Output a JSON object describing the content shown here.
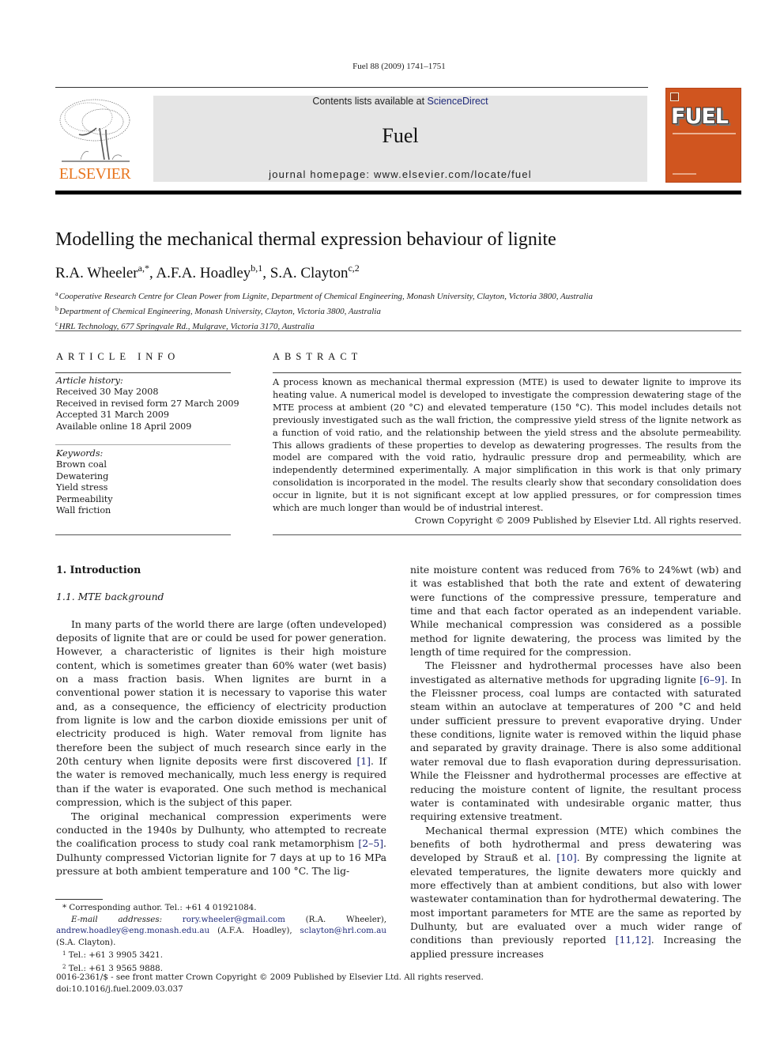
{
  "running_head": "Fuel 88 (2009) 1741–1751",
  "header": {
    "publisher_logo_text": "ELSEVIER",
    "contents_prefix": "Contents lists available at ",
    "contents_link": "ScienceDirect",
    "journal_name": "Fuel",
    "homepage": "journal homepage: www.elsevier.com/locate/fuel",
    "cover_title": "FUEL"
  },
  "colors": {
    "publisher_orange": "#e8761f",
    "cover_orange": "#d0551f",
    "link_blue": "#1f2a7a",
    "header_box_gray": "#e5e5e5"
  },
  "article": {
    "title": "Modelling the mechanical thermal expression behaviour of lignite",
    "authors": [
      {
        "name": "R.A. Wheeler",
        "sup": "a,*",
        "sep": ", "
      },
      {
        "name": "A.F.A. Hoadley",
        "sup": "b,1",
        "sep": ", "
      },
      {
        "name": "S.A. Clayton",
        "sup": "c,2",
        "sep": ""
      }
    ],
    "affiliations": [
      {
        "mark": "a",
        "text": "Cooperative Research Centre for Clean Power from Lignite, Department of Chemical Engineering, Monash University, Clayton, Victoria 3800, Australia"
      },
      {
        "mark": "b",
        "text": "Department of Chemical Engineering, Monash University, Clayton, Victoria 3800, Australia"
      },
      {
        "mark": "c",
        "text": "HRL Technology, 677 Springvale Rd., Mulgrave, Victoria 3170, Australia"
      }
    ]
  },
  "article_info": {
    "heading": "ARTICLE INFO",
    "history_label": "Article history:",
    "history": [
      "Received 30 May 2008",
      "Received in revised form 27 March 2009",
      "Accepted 31 March 2009",
      "Available online 18 April 2009"
    ],
    "keywords_label": "Keywords:",
    "keywords": [
      "Brown coal",
      "Dewatering",
      "Yield stress",
      "Permeability",
      "Wall friction"
    ]
  },
  "abstract": {
    "heading": "ABSTRACT",
    "text": "A process known as mechanical thermal expression (MTE) is used to dewater lignite to improve its heating value. A numerical model is developed to investigate the compression dewatering stage of the MTE process at ambient (20 °C) and elevated temperature (150 °C). This model includes details not previously investigated such as the wall friction, the compressive yield stress of the lignite network as a function of void ratio, and the relationship between the yield stress and the absolute permeability. This allows gradients of these properties to develop as dewatering progresses. The results from the model are compared with the void ratio, hydraulic pressure drop and permeability, which are independently determined experimentally. A major simplification in this work is that only primary consolidation is incorporated in the model. The results clearly show that secondary consolidation does occur in lignite, but it is not significant except at low applied pressures, or for compression times which are much longer than would be of industrial interest.",
    "copyright": "Crown Copyright © 2009 Published by Elsevier Ltd. All rights reserved."
  },
  "body": {
    "section_heading": "1. Introduction",
    "subsection_heading": "1.1. MTE background",
    "left_paragraphs": [
      {
        "parts": [
          {
            "t": "In many parts of the world there are large (often undeveloped) deposits of lignite that are or could be used for power generation. However, a characteristic of lignites is their high moisture content, which is sometimes greater than 60% water (wet basis) on a mass fraction basis. When lignites are burnt in a conventional power station it is necessary to vaporise this water and, as a consequence, the efficiency of electricity production from lignite is low and the carbon dioxide emissions per unit of electricity produced is high. Water removal from lignite has therefore been the subject of much research since early in the 20th century when lignite deposits were first discovered "
          },
          {
            "ref": "[1]"
          },
          {
            "t": ". If the water is removed mechanically, much less energy is required than if the water is evaporated. One such method is mechanical compression, which is the subject of this paper."
          }
        ]
      },
      {
        "parts": [
          {
            "t": "The original mechanical compression experiments were conducted in the 1940s by Dulhunty, who attempted to recreate the coalification process to study coal rank metamorphism "
          },
          {
            "ref": "[2–5]"
          },
          {
            "t": ". Dulhunty compressed Victorian lignite for 7 days at up to 16 MPa pressure at both ambient temperature and 100 °C. The lig-"
          }
        ]
      }
    ],
    "right_paragraphs": [
      {
        "noindent": true,
        "parts": [
          {
            "t": "nite moisture content was reduced from 76% to 24%wt (wb) and it was established that both the rate and extent of dewatering were functions of the compressive pressure, temperature and time and that each factor operated as an independent variable. While mechanical compression was considered as a possible method for lignite dewatering, the process was limited by the length of time required for the compression."
          }
        ]
      },
      {
        "parts": [
          {
            "t": "The Fleissner and hydrothermal processes have also been investigated as alternative methods for upgrading lignite "
          },
          {
            "ref": "[6–9]"
          },
          {
            "t": ". In the Fleissner process, coal lumps are contacted with saturated steam within an autoclave at temperatures of 200 °C and held under sufficient pressure to prevent evaporative drying. Under these conditions, lignite water is removed within the liquid phase and separated by gravity drainage. There is also some additional water removal due to flash evaporation during depressurisation. While the Fleissner and hydrothermal processes are effective at reducing the moisture content of lignite, the resultant process water is contaminated with undesirable organic matter, thus requiring extensive treatment."
          }
        ]
      },
      {
        "parts": [
          {
            "t": "Mechanical thermal expression (MTE) which combines the benefits of both hydrothermal and press dewatering was developed by Strauß et al. "
          },
          {
            "ref": "[10]"
          },
          {
            "t": ". By compressing the lignite at elevated temperatures, the lignite dewaters more quickly and more effectively than at ambient conditions, but also with lower wastewater contamination than for hydrothermal dewatering. The most important parameters for MTE are the same as reported by Dulhunty, but are evaluated over a much wider range of conditions than previously reported "
          },
          {
            "ref": "[11,12]"
          },
          {
            "t": ". Increasing the applied pressure increases"
          }
        ]
      }
    ]
  },
  "footnotes": {
    "corresponding": "* Corresponding author. Tel.: +61 4 01921084.",
    "email_label": "E-mail addresses:",
    "emails": [
      {
        "addr": "rory.wheeler@gmail.com",
        "who": " (R.A. Wheeler), "
      },
      {
        "addr": "andrew.hoadley@eng.monash.edu.au",
        "who": " (A.F.A. Hoadley), "
      },
      {
        "addr": "sclayton@hrl.com.au",
        "who": " (S.A. Clayton)."
      }
    ],
    "notes": [
      {
        "mark": "1",
        "text": "Tel.: +61 3 9905 3421."
      },
      {
        "mark": "2",
        "text": "Tel.: +61 3 9565 9888."
      }
    ]
  },
  "imprint": {
    "issn_line": "0016-2361/$ - see front matter Crown Copyright © 2009 Published by Elsevier Ltd. All rights reserved.",
    "doi": "doi:10.1016/j.fuel.2009.03.037"
  }
}
